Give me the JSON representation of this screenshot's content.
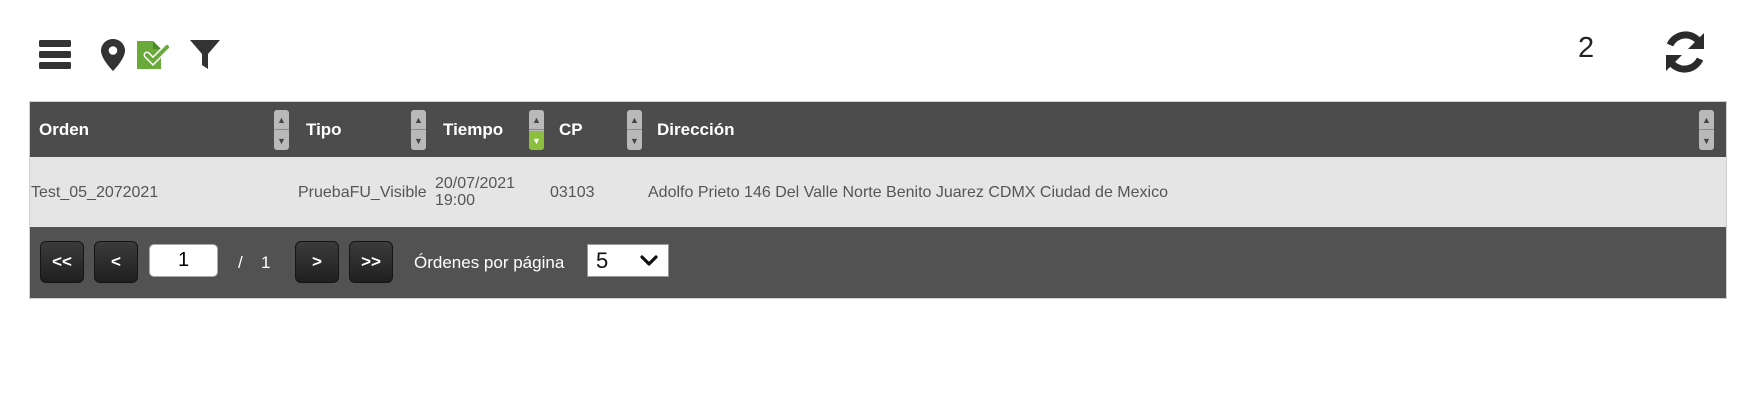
{
  "toolbar": {
    "icons": [
      "menu-icon",
      "location-pin-icon",
      "checked-document-icon",
      "filter-icon"
    ],
    "active_color": "#6aaa3a",
    "count": "2",
    "refresh_icon": "refresh-icon"
  },
  "table": {
    "columns": [
      "Orden",
      "Tipo",
      "Tiempo",
      "CP",
      "Dirección"
    ],
    "rows": [
      {
        "orden": "Test_05_2072021",
        "tipo": "PruebaFU_Visible",
        "tiempo_date": "20/07/2021",
        "tiempo_time": "19:00",
        "cp": "03103",
        "direccion": "Adolfo Prieto 146 Del Valle Norte Benito Juarez CDMX Ciudad de Mexico"
      }
    ],
    "sort_active_color": "#8cbf3f"
  },
  "pager": {
    "first_label": "<<",
    "prev_label": "<",
    "page_value": "1",
    "separator": "/",
    "total_pages": "1",
    "next_label": ">",
    "last_label": ">>",
    "per_page_label": "Órdenes por página",
    "per_page_value": "5"
  }
}
